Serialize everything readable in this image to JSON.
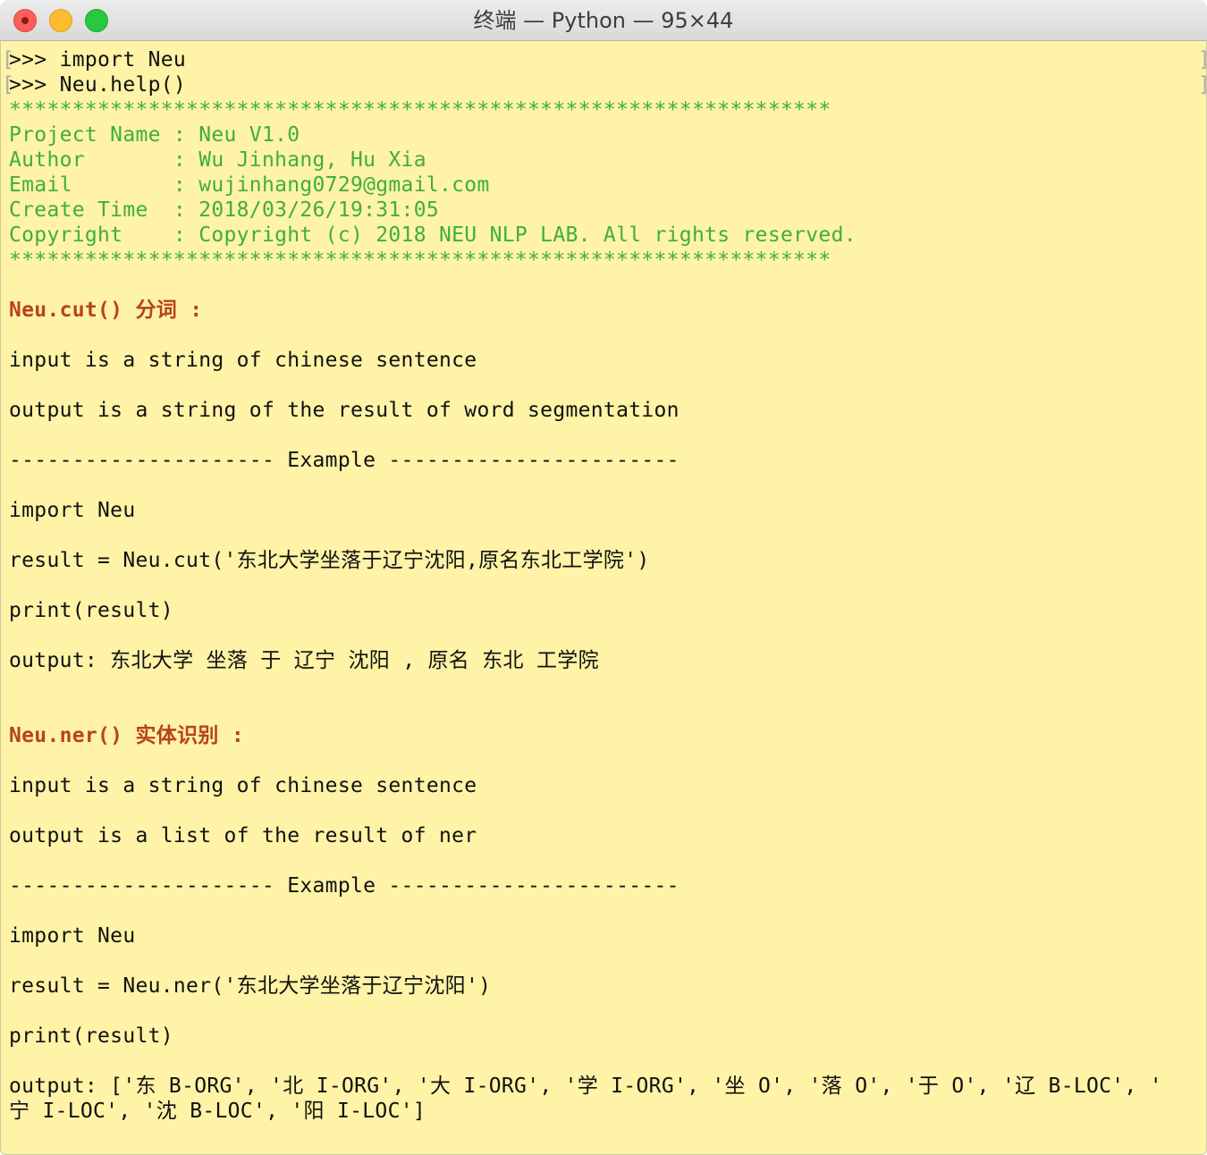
{
  "window": {
    "title": "终端 — Python — 95×44"
  },
  "terminal": {
    "lines": [
      {
        "text": ">>> import Neu",
        "style": "normal",
        "bracket": true
      },
      {
        "text": ">>> Neu.help()",
        "style": "normal",
        "bracket": true
      },
      {
        "text": "*****************************************************************",
        "style": "green"
      },
      {
        "text": "Project Name : Neu V1.0",
        "style": "green"
      },
      {
        "text": "Author       : Wu Jinhang, Hu Xia",
        "style": "green"
      },
      {
        "text": "Email        : wujinhang0729@gmail.com",
        "style": "green"
      },
      {
        "text": "Create Time  : 2018/03/26/19:31:05",
        "style": "green"
      },
      {
        "text": "Copyright    : Copyright (c) 2018 NEU NLP LAB. All rights reserved.",
        "style": "green"
      },
      {
        "text": "*****************************************************************",
        "style": "green"
      },
      {
        "text": "",
        "style": "normal"
      },
      {
        "text": "Neu.cut() 分词 :",
        "style": "red"
      },
      {
        "text": "",
        "style": "normal"
      },
      {
        "text": "input is a string of chinese sentence",
        "style": "normal"
      },
      {
        "text": "",
        "style": "normal"
      },
      {
        "text": "output is a string of the result of word segmentation",
        "style": "normal"
      },
      {
        "text": "",
        "style": "normal"
      },
      {
        "text": "--------------------- Example -----------------------",
        "style": "normal"
      },
      {
        "text": "",
        "style": "normal"
      },
      {
        "text": "import Neu",
        "style": "normal"
      },
      {
        "text": "",
        "style": "normal"
      },
      {
        "text": "result = Neu.cut('东北大学坐落于辽宁沈阳,原名东北工学院')",
        "style": "normal"
      },
      {
        "text": "",
        "style": "normal"
      },
      {
        "text": "print(result)",
        "style": "normal"
      },
      {
        "text": "",
        "style": "normal"
      },
      {
        "text": "output: 东北大学 坐落 于 辽宁 沈阳 , 原名 东北 工学院",
        "style": "normal"
      },
      {
        "text": "",
        "style": "normal"
      },
      {
        "text": "",
        "style": "normal"
      },
      {
        "text": "Neu.ner() 实体识别 :",
        "style": "red"
      },
      {
        "text": "",
        "style": "normal"
      },
      {
        "text": "input is a string of chinese sentence",
        "style": "normal"
      },
      {
        "text": "",
        "style": "normal"
      },
      {
        "text": "output is a list of the result of ner",
        "style": "normal"
      },
      {
        "text": "",
        "style": "normal"
      },
      {
        "text": "--------------------- Example -----------------------",
        "style": "normal"
      },
      {
        "text": "",
        "style": "normal"
      },
      {
        "text": "import Neu",
        "style": "normal"
      },
      {
        "text": "",
        "style": "normal"
      },
      {
        "text": "result = Neu.ner('东北大学坐落于辽宁沈阳')",
        "style": "normal"
      },
      {
        "text": "",
        "style": "normal"
      },
      {
        "text": "print(result)",
        "style": "normal"
      },
      {
        "text": "",
        "style": "normal"
      },
      {
        "text": "output: ['东 B-ORG', '北 I-ORG', '大 I-ORG', '学 I-ORG', '坐 O', '落 O', '于 O', '辽 B-LOC', '",
        "style": "normal"
      },
      {
        "text": "宁 I-LOC', '沈 B-LOC', '阳 I-LOC']",
        "style": "normal"
      }
    ]
  }
}
